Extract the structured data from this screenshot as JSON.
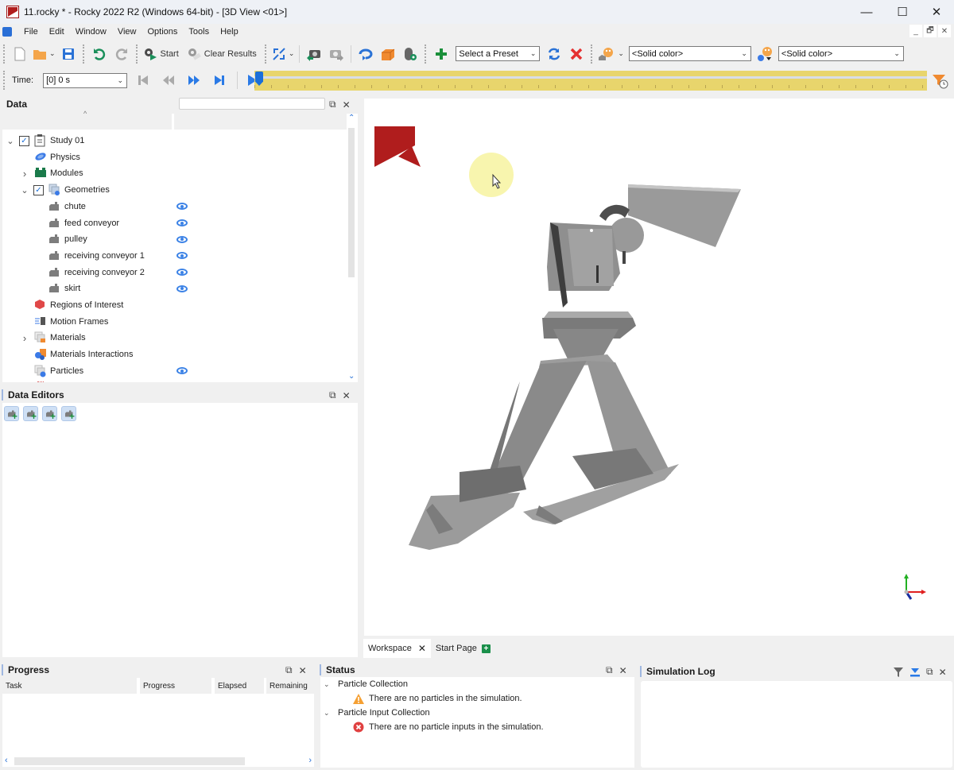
{
  "window": {
    "title": "11.rocky * - Rocky 2022 R2 (Windows 64-bit) - [3D View <01>]",
    "controls": {
      "minimize": "—",
      "maximize": "☐",
      "close": "✕"
    }
  },
  "menubar": {
    "items": [
      "File",
      "Edit",
      "Window",
      "View",
      "Options",
      "Tools",
      "Help"
    ],
    "mdi": {
      "minimize": "_",
      "restore": "🗗",
      "close": "✕"
    }
  },
  "toolbar": {
    "start_label": "Start",
    "clear_results_label": "Clear Results",
    "preset_select": "Select a Preset",
    "color_select_1": "<Solid color>",
    "color_select_2": "<Solid color>"
  },
  "timebar": {
    "time_label": "Time:",
    "time_value": "[0] 0 s",
    "timeline_position": 0
  },
  "data_panel": {
    "title": "Data",
    "search_placeholder": "",
    "tree": [
      {
        "label": "Study 01",
        "icon": "clipboard-icon",
        "level": 0,
        "expander": "collapse",
        "checked": true,
        "visible_eye": false
      },
      {
        "label": "Physics",
        "icon": "physics-planet-icon",
        "level": 1,
        "expander": "none",
        "checked": null,
        "visible_eye": false
      },
      {
        "label": "Modules",
        "icon": "modules-icon",
        "level": 1,
        "expander": "expand",
        "checked": null,
        "visible_eye": false
      },
      {
        "label": "Geometries",
        "icon": "geometries-icon",
        "level": 1,
        "expander": "collapse",
        "checked": true,
        "visible_eye": false
      },
      {
        "label": "chute",
        "icon": "geometry-icon",
        "level": 2,
        "expander": "none",
        "checked": null,
        "visible_eye": true
      },
      {
        "label": "feed conveyor",
        "icon": "geometry-icon",
        "level": 2,
        "expander": "none",
        "checked": null,
        "visible_eye": true
      },
      {
        "label": "pulley",
        "icon": "geometry-icon",
        "level": 2,
        "expander": "none",
        "checked": null,
        "visible_eye": true
      },
      {
        "label": "receiving conveyor 1",
        "icon": "geometry-icon",
        "level": 2,
        "expander": "none",
        "checked": null,
        "visible_eye": true
      },
      {
        "label": "receiving conveyor 2",
        "icon": "geometry-icon",
        "level": 2,
        "expander": "none",
        "checked": null,
        "visible_eye": true
      },
      {
        "label": "skirt",
        "icon": "geometry-icon",
        "level": 2,
        "expander": "none",
        "checked": null,
        "visible_eye": true
      },
      {
        "label": "Regions of Interest",
        "icon": "regions-icon",
        "level": 1,
        "expander": "none",
        "checked": null,
        "visible_eye": false
      },
      {
        "label": "Motion Frames",
        "icon": "motion-frames-icon",
        "level": 1,
        "expander": "none",
        "checked": null,
        "visible_eye": false
      },
      {
        "label": "Materials",
        "icon": "materials-icon",
        "level": 1,
        "expander": "expand",
        "checked": null,
        "visible_eye": false
      },
      {
        "label": "Materials Interactions",
        "icon": "materials-interactions-icon",
        "level": 1,
        "expander": "none",
        "checked": null,
        "visible_eye": false
      },
      {
        "label": "Particles",
        "icon": "particles-icon",
        "level": 1,
        "expander": "none",
        "checked": null,
        "visible_eye": true
      }
    ]
  },
  "data_editors": {
    "title": "Data Editors",
    "buttons": [
      "add-geometry",
      "add-surface",
      "add-custom-geometry",
      "add-conveyor"
    ]
  },
  "viewport": {
    "axis_colors": {
      "x": "#e02020",
      "y": "#22b022",
      "z": "#1a2fa0"
    },
    "logo_color": "#b01d1d",
    "model_color": "#8c8c8c"
  },
  "workspace_tabs": [
    {
      "label": "Workspace",
      "active": true,
      "closable": true
    },
    {
      "label": "Start Page",
      "active": false,
      "closable": false
    }
  ],
  "progress_panel": {
    "title": "Progress",
    "columns": [
      "Task",
      "Progress",
      "Elapsed",
      "Remaining"
    ],
    "rows": []
  },
  "status_panel": {
    "title": "Status",
    "groups": [
      {
        "label": "Particle Collection",
        "items": [
          {
            "severity": "warning",
            "text": "There are no particles in the simulation."
          }
        ]
      },
      {
        "label": "Particle Input Collection",
        "items": [
          {
            "severity": "error",
            "text": "There are no particle inputs in the simulation."
          }
        ]
      }
    ]
  },
  "simulation_log": {
    "title": "Simulation Log",
    "entries": []
  }
}
